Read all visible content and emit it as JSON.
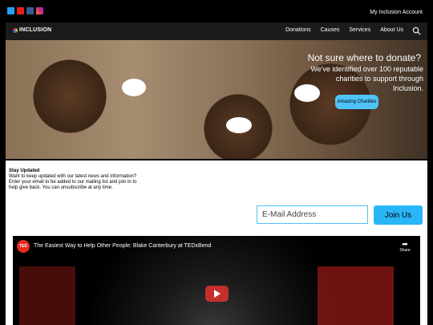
{
  "header": {
    "account_link": "My Inclusion Account",
    "social_icons": [
      "twitter-icon",
      "youtube-icon",
      "facebook-icon",
      "instagram-icon"
    ]
  },
  "nav": {
    "logo_text": "INCLUSION",
    "items": [
      "Donations",
      "Causes",
      "Services",
      "About Us"
    ],
    "search_icon": "search-icon"
  },
  "hero": {
    "headline": "Not sure where to donate?",
    "subtext": "We've identified over 100 reputable charities to support through Inclusion.",
    "button": "Amazing Charities"
  },
  "newsletter": {
    "title": "Stay Updated",
    "text": "Want to keep updated with our latest news and information? Enter your email to be added to our mailing list and join in to help give back. You can unsubscribe at any time.",
    "email_placeholder": "E-Mail Address",
    "join_button": "Join Us"
  },
  "video": {
    "channel_logo": "TED",
    "title": "The Easiest Way to Help Other People: Blake Canterbury at TEDxBend",
    "share_label": "Share"
  },
  "colors": {
    "accent": "#4fc3f7",
    "nav_bg": "#1b1b1b",
    "play_red": "#c4302b"
  }
}
